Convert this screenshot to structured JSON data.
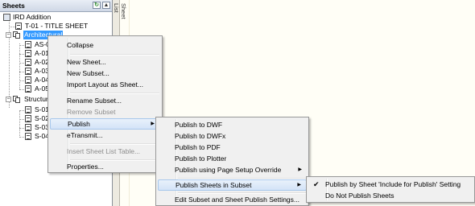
{
  "panel": {
    "title": "Sheets",
    "side_tab": "Sheet List"
  },
  "tree": {
    "root": "IRD Addition",
    "items": [
      {
        "label": "T-01 - TITLE SHEET"
      },
      {
        "label": "Architectural"
      },
      {
        "label": "AS-01"
      },
      {
        "label": "A-01"
      },
      {
        "label": "A-02"
      },
      {
        "label": "A-03"
      },
      {
        "label": "A-04"
      },
      {
        "label": "A-05"
      },
      {
        "label": "Structural"
      },
      {
        "label": "S-01"
      },
      {
        "label": "S-02"
      },
      {
        "label": "S-03"
      },
      {
        "label": "S-04"
      }
    ]
  },
  "context_menu": {
    "items": [
      {
        "label": "Collapse"
      },
      {
        "label": "New Sheet..."
      },
      {
        "label": "New Subset..."
      },
      {
        "label": "Import Layout as Sheet..."
      },
      {
        "label": "Rename Subset..."
      },
      {
        "label": "Remove Subset"
      },
      {
        "label": "Publish"
      },
      {
        "label": "eTransmit..."
      },
      {
        "label": "Insert Sheet List Table..."
      },
      {
        "label": "Properties..."
      }
    ]
  },
  "publish_menu": {
    "items": [
      {
        "label": "Publish to DWF"
      },
      {
        "label": "Publish to DWFx"
      },
      {
        "label": "Publish to PDF"
      },
      {
        "label": "Publish to Plotter"
      },
      {
        "label": "Publish using Page Setup Override"
      },
      {
        "label": "Publish Sheets in Subset"
      },
      {
        "label": "Edit Subset and Sheet Publish Settings..."
      }
    ]
  },
  "subset_menu": {
    "items": [
      {
        "label": "Publish by Sheet 'Include for Publish' Setting",
        "checked": true
      },
      {
        "label": "Do Not Publish Sheets",
        "checked": false
      }
    ]
  },
  "icons": {
    "refresh": "refresh-icon",
    "collapse": "chevron-up-icon",
    "submenu": "triangle-right-icon",
    "check": "checkmark-icon"
  }
}
